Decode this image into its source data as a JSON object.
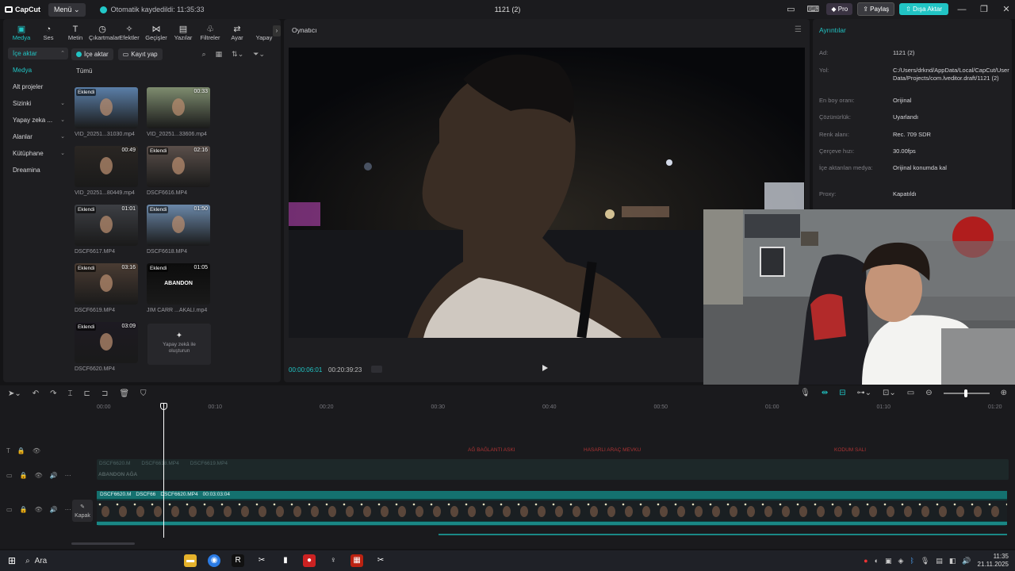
{
  "titlebar": {
    "logo": "CapCut",
    "menu": "Menü",
    "autosave": "Otomatik kaydedildi: 11:35:33",
    "project": "1121 (2)",
    "pro": "Pro",
    "share": "Paylaş",
    "export": "Dışa Aktar"
  },
  "tools": [
    {
      "label": "Medya",
      "icon": "▣"
    },
    {
      "label": "Ses",
      "icon": "◔"
    },
    {
      "label": "Metin",
      "icon": "T"
    },
    {
      "label": "Çıkartmalar",
      "icon": "◷"
    },
    {
      "label": "Efektler",
      "icon": "✧"
    },
    {
      "label": "Geçişler",
      "icon": "⋈"
    },
    {
      "label": "Yazılar",
      "icon": "▤"
    },
    {
      "label": "Filtreler",
      "icon": "♧"
    },
    {
      "label": "Ayar",
      "icon": "⇄"
    },
    {
      "label": "Yapay",
      "icon": ""
    }
  ],
  "sidenav": [
    {
      "label": "İçe aktar",
      "chev": "⌃"
    },
    {
      "label": "Medya",
      "chev": ""
    },
    {
      "label": "Alt projeler",
      "chev": ""
    },
    {
      "label": "Sizinki",
      "chev": "⌄"
    },
    {
      "label": "Yapay zeka ...",
      "chev": "⌄"
    },
    {
      "label": "Alanlar",
      "chev": "⌄"
    },
    {
      "label": "Kütüphane",
      "chev": "⌄"
    },
    {
      "label": "Dreamina",
      "chev": ""
    }
  ],
  "subbar": {
    "import": "İçe aktar",
    "record": "Kayıt yap",
    "all": "Tümü"
  },
  "media": [
    {
      "name": "VID_20251...31030.mp4",
      "badge": "Eklendi",
      "dur": ""
    },
    {
      "name": "VID_20251...33606.mp4",
      "badge": "",
      "dur": "00:33"
    },
    {
      "name": "VID_20251...80449.mp4",
      "badge": "",
      "dur": "00:49"
    },
    {
      "name": "DSCF6616.MP4",
      "badge": "Eklendi",
      "dur": "02:16"
    },
    {
      "name": "DSCF6617.MP4",
      "badge": "Eklendi",
      "dur": "01:01"
    },
    {
      "name": "DSCF6618.MP4",
      "badge": "Eklendi",
      "dur": "01:50"
    },
    {
      "name": "DSCF6619.MP4",
      "badge": "Eklendi",
      "dur": "03:16"
    },
    {
      "name": "JIM CARR ...AKALI.mp4",
      "badge": "Eklendi",
      "dur": "01:05",
      "text": "ABANDON"
    },
    {
      "name": "DSCF6620.MP4",
      "badge": "Eklendi",
      "dur": "03:09"
    }
  ],
  "ai_tile": "Yapay zekâ ile oluşturun",
  "player": {
    "title": "Oynatıcı",
    "current": "00:00:06:01",
    "total": "00:20:39:23"
  },
  "details": {
    "title": "Ayrıntılar",
    "rows": [
      {
        "k": "Ad:",
        "v": "1121 (2)"
      },
      {
        "k": "Yol:",
        "v": "C:/Users/drknd/AppData/Local/CapCut/User Data/Projects/com.lveditor.draft/1121 (2)"
      },
      {
        "k": "En boy oranı:",
        "v": "Orijinal"
      },
      {
        "k": "Çözünürlük:",
        "v": "Uyarlandı"
      },
      {
        "k": "Renk alanı:",
        "v": "Rec. 709 SDR"
      },
      {
        "k": "Çerçeve hızı:",
        "v": "30.00fps"
      },
      {
        "k": "İçe aktarılan medya:",
        "v": "Orijinal konumda kal"
      },
      {
        "k": "Proxy:",
        "v": "Kapatıldı"
      }
    ]
  },
  "timeline": {
    "ruler": [
      "00:00",
      "00:10",
      "00:20",
      "00:30",
      "00:40",
      "00:50",
      "01:00",
      "01:10",
      "01:20"
    ],
    "clip_top": [
      "ABANDON AĞA",
      "DSCF6620.M",
      "DSCF6618.MP4",
      "DSCF6619.MP4"
    ],
    "clip_main": [
      "DSCF6620.M",
      "DSCF66",
      "DSCF6620.MP4",
      "00:03:03:04"
    ],
    "red_labels": [
      "AĞ BAĞLANTI ASKI",
      "HASARLI ARAÇ MEVKU",
      "KODUM SALI"
    ],
    "kapak": "Kapak"
  },
  "taskbar": {
    "search": "Ara",
    "time": "11:35",
    "date": "21.11.2025"
  },
  "colors": {
    "accent": "#21c4c4",
    "bg": "#141416",
    "panel": "#1e1e21"
  }
}
